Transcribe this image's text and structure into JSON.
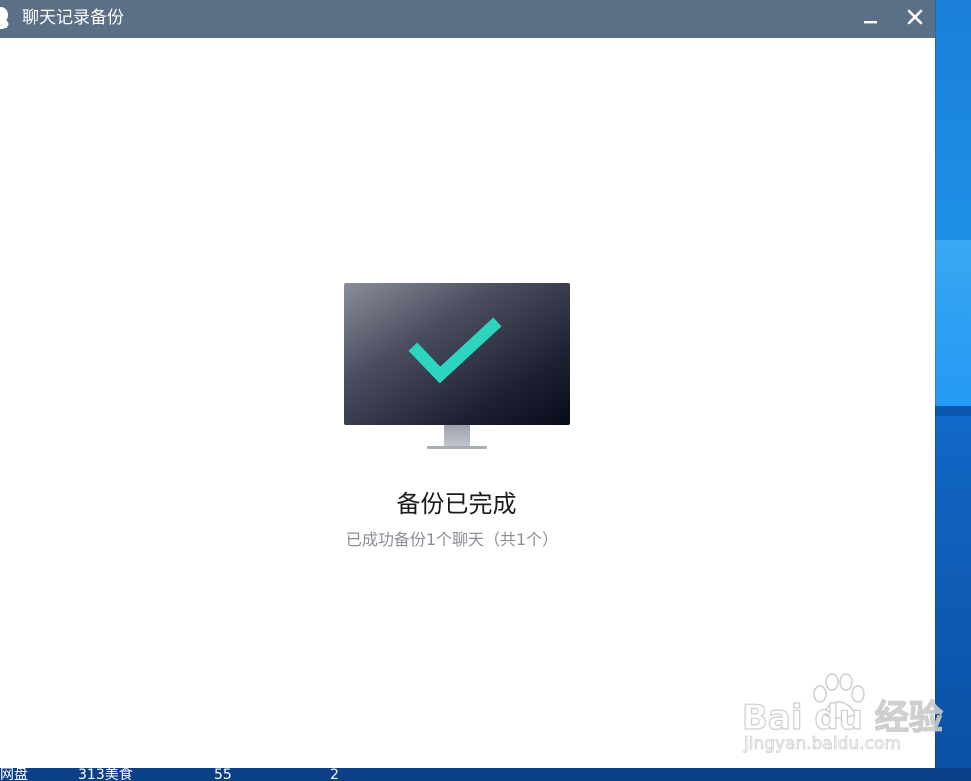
{
  "window": {
    "title": "聊天记录备份",
    "icon": "qq-penguin-icon",
    "minimize_icon": "minimize-icon",
    "close_icon": "close-icon",
    "titlebar_color": "#5b6f87"
  },
  "main": {
    "illustration": "monitor-checkmark-icon",
    "check_color": "#2dd4bf",
    "heading": "备份已完成",
    "subtext": "已成功备份1个聊天（共1个）"
  },
  "desktop": {
    "bottom_strip": [
      "网盘",
      "313美食",
      "55",
      "2"
    ]
  },
  "watermark": {
    "logo": "Bai du 经验",
    "url": "jingyan.baidu.com"
  }
}
